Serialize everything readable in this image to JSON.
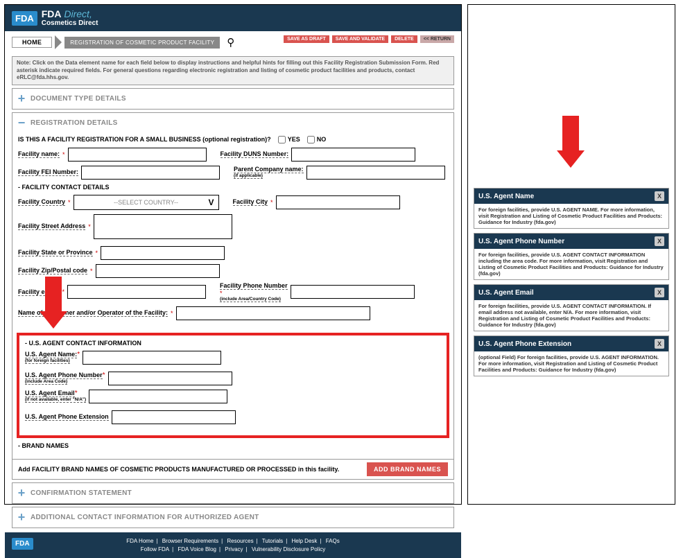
{
  "header": {
    "logo": "FDA",
    "title_bold": "FDA",
    "title_light": "Direct,",
    "subtitle": "Cosmetics Direct"
  },
  "breadcrumb": {
    "home": "HOME",
    "current": "REGISTRATION OF COSMETIC PRODUCT FACILITY"
  },
  "actions": {
    "save_draft": "SAVE AS DRAFT",
    "save_validate": "SAVE AND VALIDATE",
    "delete": "DELETE",
    "return": "<< RETURN"
  },
  "note": "Note: Click on the Data element name for each field below to display instructions and helpful hints for filling out this Facility Registration Submission Form. Red asterisk indicate required fields. For general questions regarding electronic registration and listing of cosmetic product facilities and products, contact eRLC@fda.hhs.gov.",
  "sections": {
    "doc_type": "DOCUMENT TYPE DETAILS",
    "reg_details": "REGISTRATION DETAILS",
    "confirm": "CONFIRMATION STATEMENT",
    "additional": "ADDITIONAL CONTACT INFORMATION FOR AUTHORIZED AGENT"
  },
  "reg": {
    "small_biz_q": "IS THIS A FACILITY REGISTRATION FOR A SMALL BUSINESS (optional registration)?",
    "yes": "YES",
    "no": "NO",
    "facility_name": "Facility name:",
    "facility_duns": "Facility DUNS Number:",
    "fei_number": "Facility FEI Number:",
    "parent_company": "Parent Company name:",
    "parent_company_sub": "(if applicable)",
    "contact_head": "- FACILITY CONTACT DETAILS",
    "country": "Facility Country",
    "country_placeholder": "--SELECT COUNTRY--",
    "city": "Facility City",
    "street": "Facility Street Address",
    "state": "Facility State or Province",
    "zip": "Facility Zip/Postal code",
    "email": "Facility e-mail",
    "phone": "Facility Phone Number",
    "phone_sub": "(include Area/Country Code)",
    "owner": "Name of the Owner and/or Operator of the Facility:"
  },
  "agent": {
    "head": "- U.S. AGENT CONTACT INFORMATION",
    "name": "U.S. Agent Name:",
    "name_sub": "(for foreign facilities)",
    "phone": "U.S. Agent Phone Number",
    "phone_sub": "(include Area Code)",
    "email": "U.S. Agent Email",
    "email_sub": "(if not available, enter \"N/A\")",
    "ext": "U.S. Agent Phone Extension"
  },
  "brand": {
    "head": "- BRAND NAMES",
    "text": "Add FACILITY BRAND NAMES OF COSMETIC PRODUCTS MANUFACTURED OR PROCESSED in this facility.",
    "btn": "ADD BRAND NAMES"
  },
  "footer": {
    "links1": [
      "FDA Home",
      "Browser Requirements",
      "Resources",
      "Tutorials",
      "Help Desk",
      "FAQs"
    ],
    "links2": [
      "Follow FDA",
      "FDA Voice Blog",
      "Privacy",
      "Vulnerability Disclosure Policy"
    ]
  },
  "help": [
    {
      "title": "U.S. Agent Name",
      "body": "For foreign facilities, provide U.S. AGENT NAME. For more information, visit Registration and Listing of Cosmetic Product Facilities and Products: Guidance for Industry (fda.gov)"
    },
    {
      "title": "U.S. Agent Phone Number",
      "body": "For foreign facilities, provide U.S. AGENT CONTACT INFORMATION including the area code. For more information, visit Registration and Listing of Cosmetic Product Facilities and Products: Guidance for Industry (fda.gov)"
    },
    {
      "title": "U.S. Agent Email",
      "body": "For foreign facilities, provide U.S. AGENT CONTACT INFORMATION. If email address not available, enter N/A. For more information, visit Registration and Listing of Cosmetic Product Facilities and Products: Guidance for Industry (fda.gov)"
    },
    {
      "title": "U.S. Agent Phone Extension",
      "body": "(optional Field) For foreign facilities, provide U.S. AGENT INFORMATION. For more information, visit Registration and Listing of Cosmetic Product Facilities and Products: Guidance for Industry (fda.gov)"
    }
  ]
}
